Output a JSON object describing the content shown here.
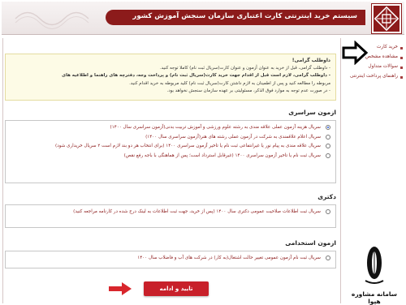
{
  "header": {
    "title": "سیستم خرید اینترنتی کارت اعتباری سازمان سنجش آموزش کشور"
  },
  "sidebar": {
    "items": [
      {
        "label": "خرید کارت"
      },
      {
        "label": "مشاهده مشخص"
      },
      {
        "label": "سوالات متداول"
      },
      {
        "label": "راهنمای پرداخت اینترنتی"
      }
    ]
  },
  "notice": {
    "title": "داوطلب گرامی!",
    "lines": [
      "- داوطلب گرامی، قبل از خرید به عنوان آزمون و عنوان کارت(سریال ثبت نام) کاملا توجه کنید.",
      "- داوطلب گرامی، لازم است قبل از اقدام جهت خرید کارت(سریال ثبت نام) و پرداخت وجه، دفترچه های راهنما و اطلاعیه های",
      "مربوطه را مطالعه کنید و پس از اطمینان به لازم داشتن کارت(سریال ثبت نام) کلید مربوطه به خرید اقدام کنید.",
      "- در صورت عدم توجه به موارد فوق الذکر، مسئولیتی بر عهده سازمان سنجش نخواهد بود."
    ]
  },
  "sections": [
    {
      "title": "ازمون سراسری",
      "options": [
        {
          "text": "سریال هزینه آزمون عملی علاقه مندی به رشته علوم ورزشی و آموزش تربیت بدنی(آزمون سراسری سال ۱۴۰۰)",
          "checked": true
        },
        {
          "text": "سریال اعلام علاقمندی به شرکت در آزمون عملی رشته های هنر(آزمون سراسری سال ۱۴۰۰)",
          "checked": false
        },
        {
          "text": "سریال علاقه مندی به پیام نور یا غیرانتفاعی ثبت نام یا تاخیر آزمون سراسری ۱۴۰۰ (برای انتخاب هر دو بند لازم است ۲ سریال خریداری شود)",
          "checked": false
        },
        {
          "text": "سریال ثبت نام یا تاخیر آزمون سراسری ۱۴۰۰ (غیرقابل استرداد است؛ پس از هماهنگی با باجه رفع نقص)",
          "checked": false
        }
      ]
    },
    {
      "title": "دکتری",
      "options": [
        {
          "text": "سریال ثبت اطلاعات صلاحیت عمومی دکتری سال ۱۴۰۰ (پس از خرید، جهت ثبت اطلاعات به لینک درج شده در کارنامه مراجعه کنید)",
          "checked": false
        }
      ]
    },
    {
      "title": "ازمون استخدامی",
      "options": [
        {
          "text": "سریال ثبت نام آزمون عمومی تغییر حالت اشتغال(به کار) در شرکت های آب و فاضلاب سال ۱۴۰۰",
          "checked": false
        }
      ]
    }
  ],
  "submit": {
    "label": "تایید و ادامه"
  },
  "watermark": {
    "text": "سامانه مشاوره هپوا"
  },
  "colors": {
    "brand": "#8c1b1b",
    "submit": "#c8202a",
    "radio_checked": "#2a5bd7"
  }
}
